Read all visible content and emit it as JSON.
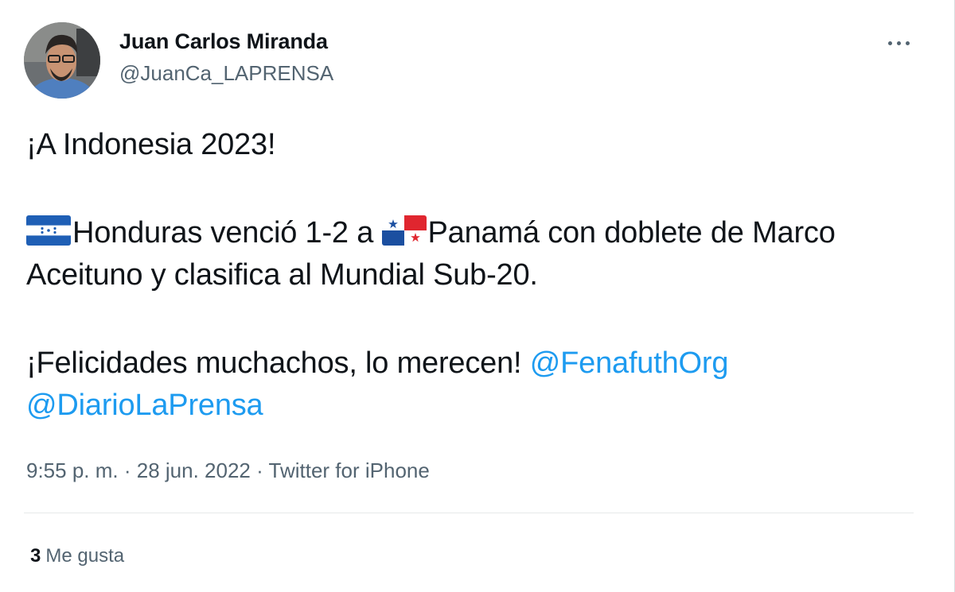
{
  "author": {
    "name": "Juan Carlos Miranda",
    "handle": "@JuanCa_LAPRENSA",
    "avatar": "profile-photo"
  },
  "menu": {
    "icon": "more-horizontal-icon"
  },
  "tweet": {
    "line1": "¡A Indonesia 2023!",
    "flag_honduras": "honduras-flag-icon",
    "text_a": "Honduras venció 1-2 a ",
    "flag_panama": "panama-flag-icon",
    "text_b": "Panamá con doblete de Marco Aceituno y clasifica al Mundial Sub-20.",
    "text_c": "¡Felicidades muchachos, lo merecen! ",
    "mention1": "@FenafuthOrg",
    "mention2": "@DiarioLaPrensa"
  },
  "meta": {
    "time": "9:55 p. m.",
    "sep1": " · ",
    "date": "28 jun. 2022",
    "sep2": " · ",
    "source": "Twitter for iPhone"
  },
  "stats": {
    "likes_count": "3",
    "likes_label": "Me gusta"
  },
  "colors": {
    "link": "#1d9bf0",
    "secondary_text": "#536471",
    "primary_text": "#0f1419"
  }
}
